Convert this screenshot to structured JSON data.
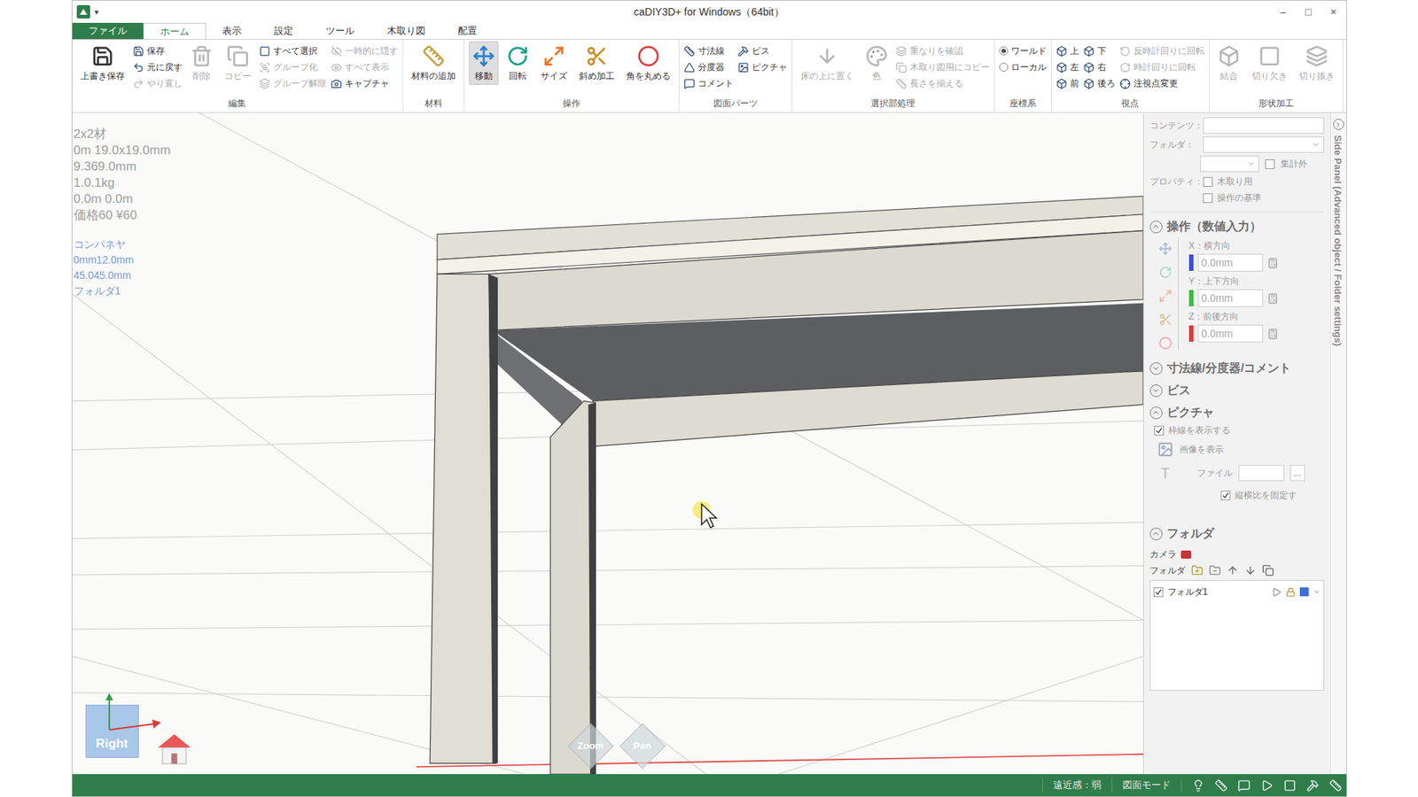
{
  "window": {
    "title": "caDIY3D+ for Windows（64bit）",
    "quick_access": "▾",
    "controls": [
      "–",
      "□",
      "×"
    ]
  },
  "tabs": [
    {
      "label": "ファイル",
      "selected": false,
      "kind": "file"
    },
    {
      "label": "ホーム",
      "selected": true,
      "kind": "tab"
    },
    {
      "label": "表示",
      "selected": false,
      "kind": "tab"
    },
    {
      "label": "設定",
      "selected": false,
      "kind": "tab"
    },
    {
      "label": "ツール",
      "selected": false,
      "kind": "tab"
    },
    {
      "label": "木取り図",
      "selected": false,
      "kind": "tab"
    },
    {
      "label": "配置",
      "selected": false,
      "kind": "tab"
    }
  ],
  "ribbon": [
    {
      "label": "編集",
      "items": [
        {
          "kind": "large",
          "label": "上書き保存",
          "disabled": false,
          "selected": false
        },
        {
          "kind": "column",
          "items": [
            {
              "kind": "small",
              "label": "保存",
              "disabled": false
            },
            {
              "kind": "small",
              "label": "元に戻す",
              "disabled": false
            },
            {
              "kind": "small",
              "label": "やり直し",
              "disabled": true
            }
          ]
        },
        {
          "kind": "large",
          "label": "削除",
          "disabled": true,
          "selected": false
        },
        {
          "kind": "large",
          "label": "コピー",
          "disabled": true,
          "selected": false
        },
        {
          "kind": "column",
          "items": [
            {
              "kind": "small",
              "label": "すべて選択",
              "disabled": false
            },
            {
              "kind": "small",
              "label": "グループ化",
              "disabled": true
            },
            {
              "kind": "small",
              "label": "グループ解除",
              "disabled": true
            }
          ]
        },
        {
          "kind": "column",
          "items": [
            {
              "kind": "small",
              "label": "一時的に隠す",
              "disabled": true
            },
            {
              "kind": "small",
              "label": "すべて表示",
              "disabled": true
            },
            {
              "kind": "small",
              "label": "キャプチャ",
              "disabled": false
            }
          ]
        }
      ]
    },
    {
      "label": "材料",
      "items": [
        {
          "kind": "large",
          "label": "材料の追加",
          "disabled": false,
          "selected": false
        }
      ]
    },
    {
      "label": "操作",
      "items": [
        {
          "kind": "large",
          "label": "移動",
          "disabled": false,
          "selected": true
        },
        {
          "kind": "large",
          "label": "回転",
          "disabled": false,
          "selected": false
        },
        {
          "kind": "large",
          "label": "サイズ",
          "disabled": false,
          "selected": false
        },
        {
          "kind": "large",
          "label": "斜め加工",
          "disabled": false,
          "selected": false
        },
        {
          "kind": "large",
          "label": "角を丸める",
          "disabled": false,
          "selected": false
        }
      ]
    },
    {
      "label": "図面パーツ",
      "items": [
        {
          "kind": "column",
          "items": [
            {
              "kind": "small",
              "label": "寸法線",
              "disabled": false
            },
            {
              "kind": "small",
              "label": "分度器",
              "disabled": false
            },
            {
              "kind": "small",
              "label": "コメント",
              "disabled": false
            }
          ]
        },
        {
          "kind": "column",
          "items": [
            {
              "kind": "small",
              "label": "ビス",
              "disabled": false
            },
            {
              "kind": "small",
              "label": "ピクチャ",
              "disabled": false
            }
          ]
        }
      ]
    },
    {
      "label": "選択部処理",
      "items": [
        {
          "kind": "large",
          "label": "床の上に置く",
          "disabled": true,
          "selected": false
        },
        {
          "kind": "large",
          "label": "色",
          "disabled": true,
          "selected": false
        },
        {
          "kind": "column",
          "items": [
            {
              "kind": "small",
              "label": "重なりを確認",
              "disabled": true
            },
            {
              "kind": "small",
              "label": "木取り図用にコピー",
              "disabled": true
            },
            {
              "kind": "small",
              "label": "長さを揃える",
              "disabled": true
            }
          ]
        }
      ]
    },
    {
      "label": "座標系",
      "items": [
        {
          "kind": "column",
          "items": [
            {
              "kind": "radio",
              "label": "ワールド",
              "disabled": false,
              "selected": true
            },
            {
              "kind": "radio",
              "label": "ローカル",
              "disabled": false,
              "selected": false
            }
          ]
        }
      ]
    },
    {
      "label": "視点",
      "items": [
        {
          "kind": "column",
          "items": [
            {
              "kind": "small",
              "label": "上",
              "disabled": false
            },
            {
              "kind": "small",
              "label": "左",
              "disabled": false
            },
            {
              "kind": "small",
              "label": "前",
              "disabled": false
            }
          ]
        },
        {
          "kind": "column",
          "items": [
            {
              "kind": "small",
              "label": "下",
              "disabled": false
            },
            {
              "kind": "small",
              "label": "右",
              "disabled": false
            },
            {
              "kind": "small",
              "label": "後ろ",
              "disabled": false
            }
          ]
        },
        {
          "kind": "column",
          "items": [
            {
              "kind": "small",
              "label": "反時計回りに回転",
              "disabled": true
            },
            {
              "kind": "small",
              "label": "時計回りに回転",
              "disabled": true
            },
            {
              "kind": "small",
              "label": "注視点変更",
              "disabled": false
            }
          ]
        }
      ]
    },
    {
      "label": "形状加工",
      "items": [
        {
          "kind": "large",
          "label": "結合",
          "disabled": true,
          "selected": false
        },
        {
          "kind": "large",
          "label": "切り欠き",
          "disabled": true,
          "selected": false
        },
        {
          "kind": "large",
          "label": "切り抜き",
          "disabled": true,
          "selected": false
        }
      ]
    }
  ],
  "viewport": {
    "info_lines": [
      "2x2材",
      "0m 19.0x19.0mm",
      "9.369.0mm",
      "1.0.1kg",
      "0.0m 0.0m",
      "価格60 ¥60"
    ],
    "info_lines_blue": [
      "コンパネヤ",
      "0mm12.0mm",
      "45.045.0mm",
      "フォルダ1"
    ],
    "view_cube": "Right",
    "zoom": "Zoom",
    "pan": "Pan"
  },
  "side_panel": {
    "content_label": "コンテンツ：",
    "folder_label": "フォルダ：",
    "exclude": {
      "label": "集計外",
      "checked": false
    },
    "property_label": "プロパティ：",
    "properties": [
      {
        "label": "木取り用",
        "checked": false
      },
      {
        "label": "操作の基準",
        "checked": false
      }
    ],
    "operation": {
      "title": "操作（数値入力）",
      "expanded": true,
      "fields": [
        {
          "label": "X：横方向",
          "value": "0.0mm",
          "color": "#3b4fd8"
        },
        {
          "label": "Y：上下方向",
          "value": "0.0mm",
          "color": "#3dbb3d"
        },
        {
          "label": "Z：前後方向",
          "value": "0.0mm",
          "color": "#d83b3b"
        }
      ]
    },
    "collapsed": [
      {
        "title": "寸法線/分度器/コメント",
        "expanded": false
      },
      {
        "title": "ビス",
        "expanded": false
      }
    ],
    "picture": {
      "title": "ピクチャ",
      "expanded": true,
      "frame": {
        "label": "枠線を表示する",
        "checked": true
      },
      "show_image": "画像を表示",
      "file_label": "ファイル",
      "browse": "...",
      "aspect": {
        "label": "縦横比を固定す",
        "checked": true
      }
    },
    "folders": {
      "title": "フォルダ",
      "expanded": true,
      "camera": "カメラ",
      "folder_label": "フォルダ",
      "rows": [
        {
          "name": "フォルダ1",
          "checked": true,
          "locked": true,
          "color": "#3b6fe0"
        }
      ]
    },
    "side_tab": "Side Panel (Advanced object / Folder settings)"
  },
  "status_bar": {
    "items": [
      "遠近感：弱",
      "図面モード"
    ]
  }
}
